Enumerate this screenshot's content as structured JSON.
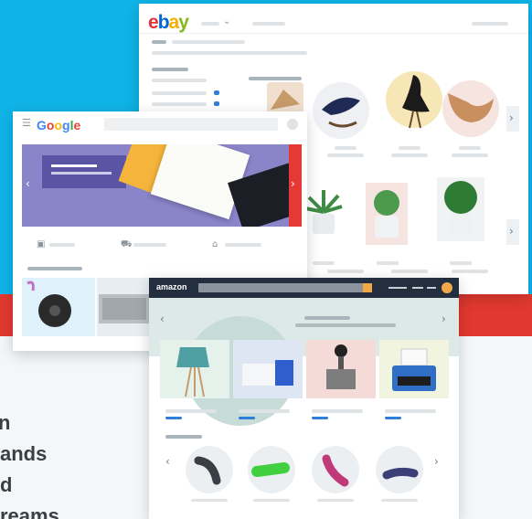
{
  "tagline": {
    "lines": [
      "n",
      "ands",
      "d",
      "reams"
    ]
  },
  "ebay": {
    "logo": {
      "e": "e",
      "b": "b",
      "a": "a",
      "y": "y"
    },
    "brand_colors": {
      "red": "#e53238",
      "blue": "#0064d2",
      "yellow": "#f5af02",
      "green": "#86b817"
    },
    "products_row1": [
      "bird-sculpture-icon",
      "bird-sculpture-icon",
      "bowl-sculpture-icon"
    ],
    "products_row2": [
      "plant-icon",
      "plant-icon",
      "plant-icon"
    ]
  },
  "google": {
    "logo": {
      "G": "G",
      "o1": "o",
      "o2": "o",
      "g": "g",
      "l": "l",
      "e": "e"
    },
    "brand_colors": {
      "blue": "#4285f4",
      "red": "#ea4335",
      "yellow": "#fbbc05",
      "green": "#34a853"
    },
    "icons": [
      "store-icon",
      "cart-icon",
      "home-icon"
    ]
  },
  "amazon": {
    "logo": "amazon",
    "accent": "#f3a847",
    "header_color": "#232f3e",
    "products": [
      "lamp-icon",
      "box-icon",
      "stamp-icon",
      "typewriter-icon"
    ],
    "accessories": [
      "tube-icon",
      "tube-icon",
      "tube-icon",
      "tube-icon"
    ]
  }
}
